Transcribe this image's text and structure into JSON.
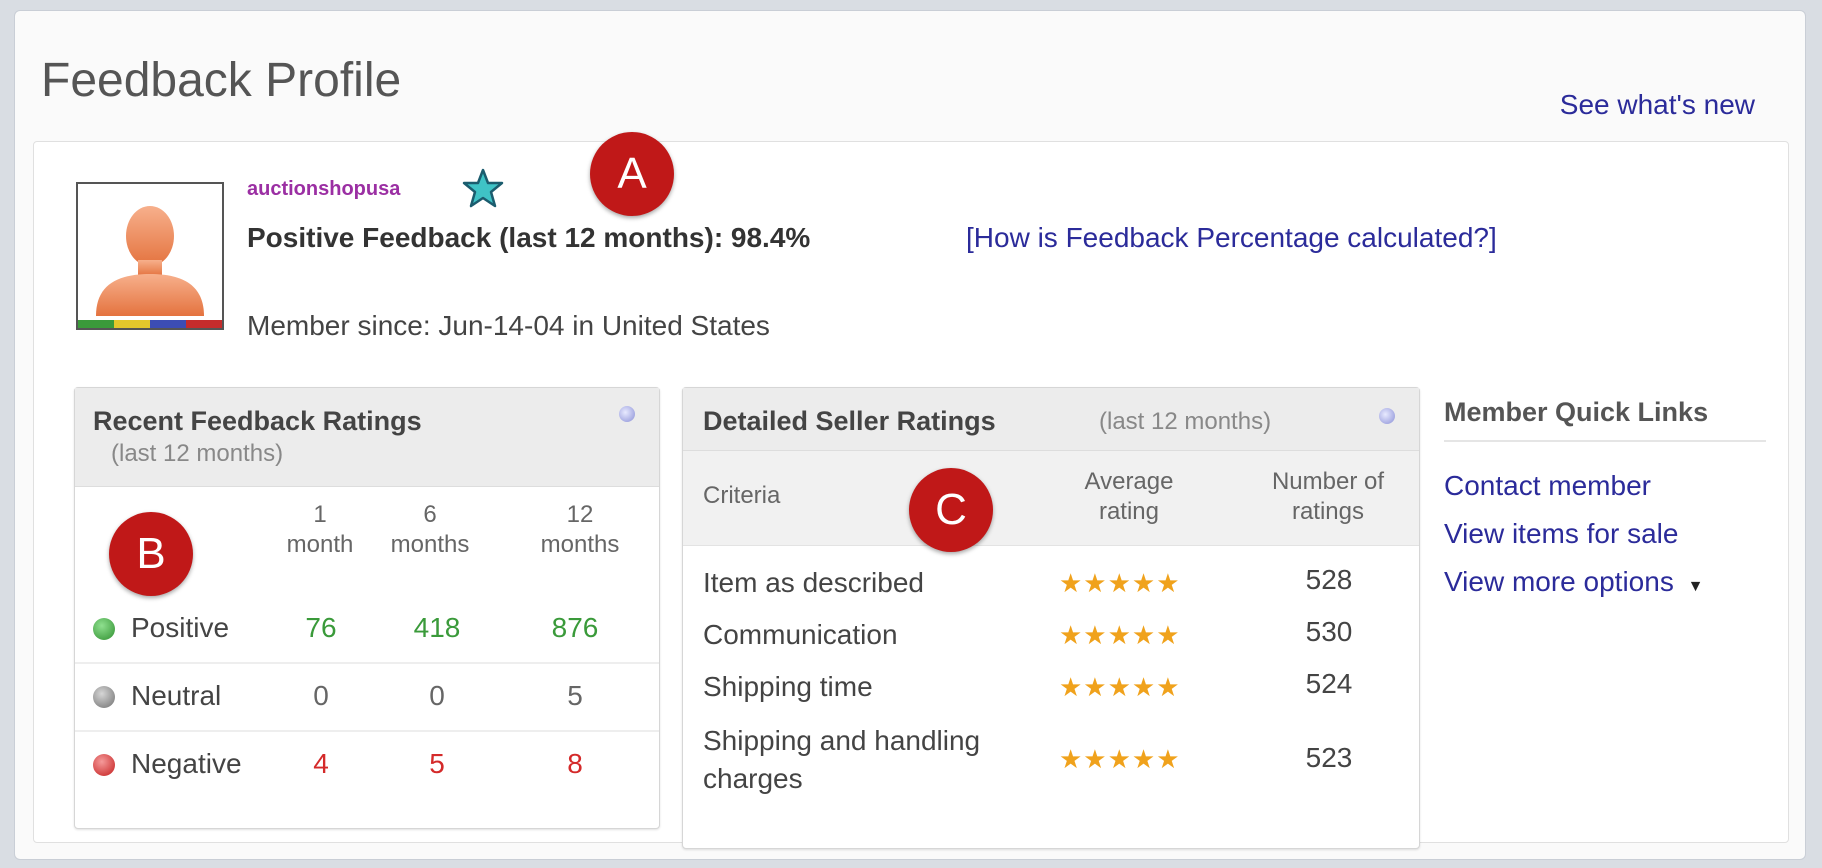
{
  "header": {
    "title": "Feedback Profile",
    "whats_new_link": "See what's new"
  },
  "profile": {
    "username": "auctionshopusa",
    "positive_feedback": "Positive Feedback (last 12 months): 98.4%",
    "percentage_link": "[How is Feedback Percentage calculated?]",
    "member_since": "Member since: Jun-14-04 in United States"
  },
  "markers": {
    "a": "A",
    "b": "B",
    "c": "C"
  },
  "recent_feedback": {
    "title": "Recent Feedback Ratings",
    "subtitle": "(last 12 months)",
    "columns": [
      {
        "line1": "1",
        "line2": "month"
      },
      {
        "line1": "6",
        "line2": "months"
      },
      {
        "line1": "12",
        "line2": "months"
      }
    ],
    "rows": [
      {
        "label": "Positive",
        "values": [
          "76",
          "418",
          "876"
        ]
      },
      {
        "label": "Neutral",
        "values": [
          "0",
          "0",
          "5"
        ]
      },
      {
        "label": "Negative",
        "values": [
          "4",
          "5",
          "8"
        ]
      }
    ]
  },
  "detailed_ratings": {
    "title": "Detailed Seller Ratings",
    "subtitle": "(last 12 months)",
    "col_criteria": "Criteria",
    "col_avg_line1": "Average",
    "col_avg_line2": "rating",
    "col_num_line1": "Number of",
    "col_num_line2": "ratings",
    "rows": [
      {
        "criteria": "Item as described",
        "stars": "★★★★★",
        "rating": 5.0,
        "count": "528"
      },
      {
        "criteria": "Communication",
        "stars": "★★★★★",
        "rating": 5.0,
        "count": "530"
      },
      {
        "criteria": "Shipping time",
        "stars": "★★★★★",
        "rating": 4.9,
        "count": "524"
      },
      {
        "criteria_line1": "Shipping and handling",
        "criteria_line2": "charges",
        "stars": "★★★★★",
        "rating": 4.8,
        "count": "523"
      }
    ]
  },
  "quick_links": {
    "title": "Member Quick Links",
    "items": [
      "Contact member",
      "View items for sale",
      "View more options"
    ]
  },
  "colors": {
    "link": "#2b2b9a",
    "username": "#9b2fa3",
    "marker": "#c01818",
    "positive": "#3a9a3a",
    "negative": "#d42a2a",
    "star": "#f0a21c"
  }
}
